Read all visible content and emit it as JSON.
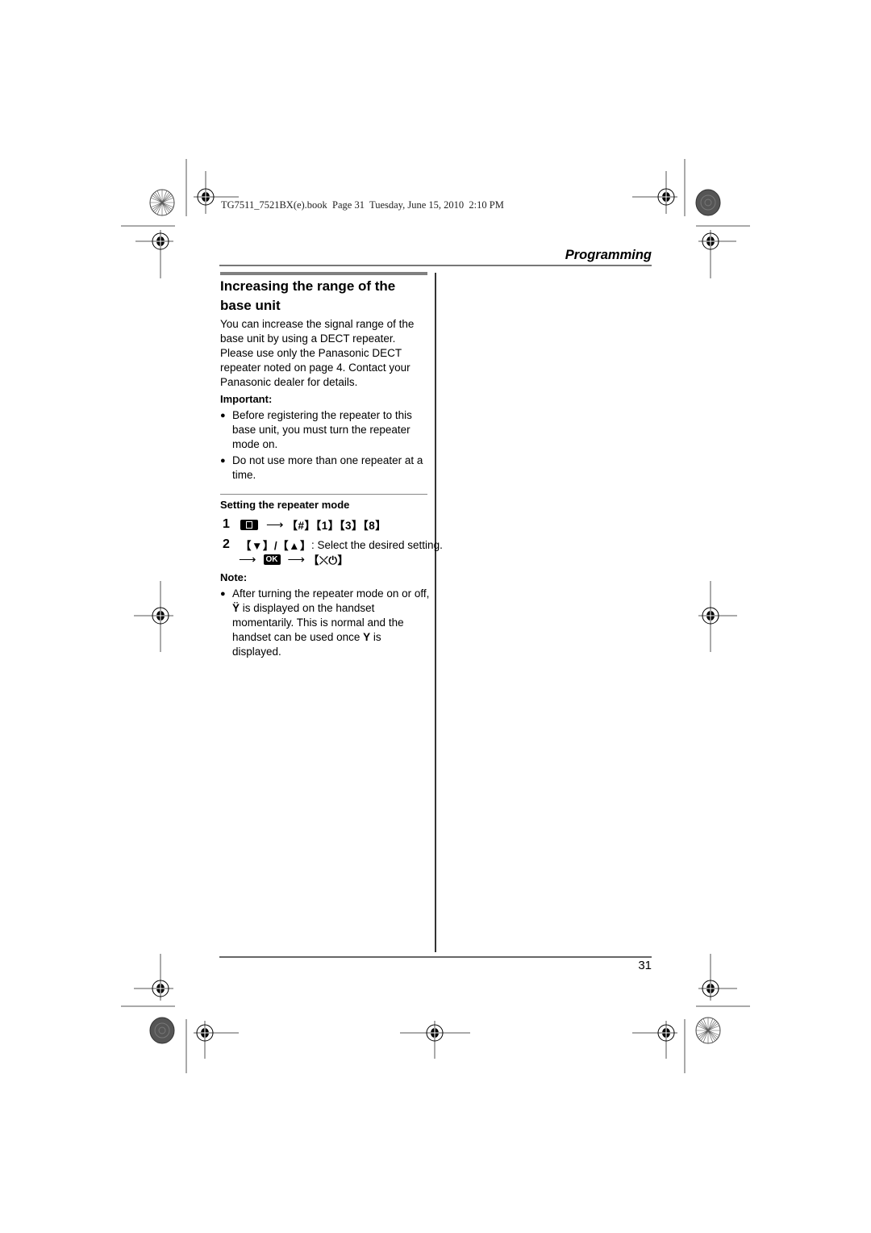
{
  "print_header": "TG7511_7521BX(e).book  Page 31  Tuesday, June 15, 2010  2:10 PM",
  "section_label": "Programming",
  "title": "Increasing the range of the base unit",
  "intro": "You can increase the signal range of the base unit by using a DECT repeater. Please use only the Panasonic DECT repeater noted on page 4. Contact your Panasonic dealer for details.",
  "important": {
    "label": "Important:",
    "bullets": [
      "Before registering the repeater to this base unit, you must turn the repeater mode on.",
      "Do not use more than one repeater at a time."
    ]
  },
  "subsection": {
    "heading": "Setting the repeater mode",
    "steps": [
      {
        "num": "1",
        "menu_icon": "menu-key-icon",
        "keys": "【#】【1】【3】【8】"
      },
      {
        "num": "2",
        "keys_prefix": "【▼】/【▲】",
        "text": ": Select the desired setting.",
        "ok_label": "OK",
        "end_key": "【⤬⏻】"
      }
    ]
  },
  "note": {
    "label": "Note:",
    "bullets": [
      {
        "part1": "After turning the repeater mode on or off, ",
        "icon1": "Ÿ",
        "part2": " is displayed on the handset momentarily. This is normal and the handset can be used once ",
        "icon2": "Y",
        "part3": " is displayed."
      }
    ]
  },
  "page_number": "31"
}
